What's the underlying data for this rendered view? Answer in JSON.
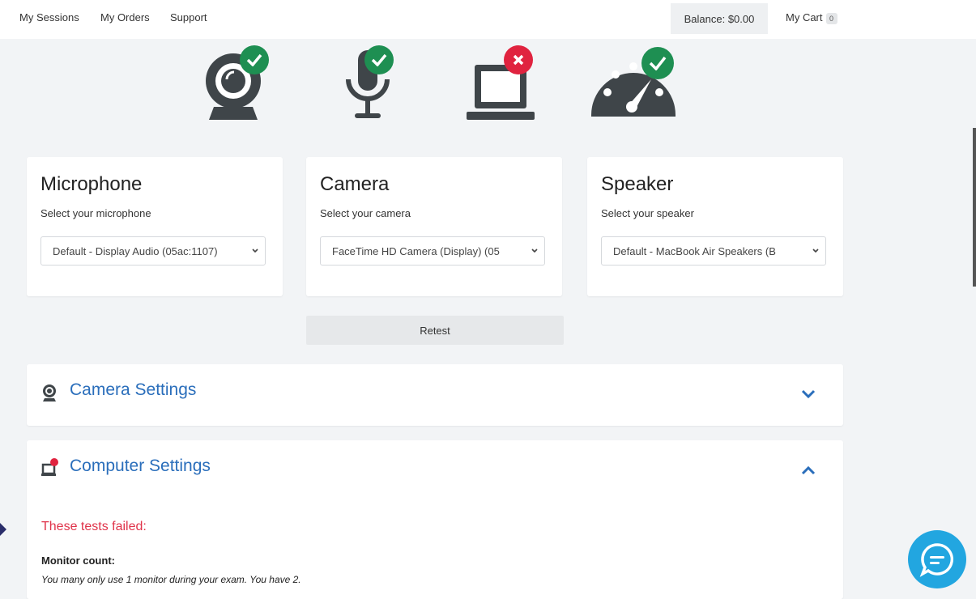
{
  "topnav": {
    "links": [
      "My Sessions",
      "My Orders",
      "Support"
    ],
    "balance": "Balance: $0.00",
    "cart_label": "My Cart",
    "cart_count": "0"
  },
  "status_icons": [
    {
      "name": "webcam",
      "status": "pass"
    },
    {
      "name": "microphone",
      "status": "pass"
    },
    {
      "name": "computer",
      "status": "fail"
    },
    {
      "name": "speedometer",
      "status": "pass"
    }
  ],
  "colors": {
    "pass": "#1e8f52",
    "fail": "#e0233f",
    "icon": "#3f4549",
    "link": "#2a6ebb",
    "chat": "#22a6e0"
  },
  "devices": {
    "microphone": {
      "title": "Microphone",
      "subtitle": "Select your microphone",
      "selected": "Default - Display Audio (05ac:1107)"
    },
    "camera": {
      "title": "Camera",
      "subtitle": "Select your camera",
      "selected": "FaceTime HD Camera (Display) (05"
    },
    "speaker": {
      "title": "Speaker",
      "subtitle": "Select your speaker",
      "selected": "Default - MacBook Air Speakers (B"
    }
  },
  "retest_label": "Retest",
  "panels": {
    "camera_settings": {
      "title": "Camera Settings",
      "expanded": false
    },
    "computer_settings": {
      "title": "Computer Settings",
      "expanded": true,
      "failed_heading": "These tests failed:",
      "tests": [
        {
          "label": "Monitor count:",
          "description": "You many only use 1 monitor during your exam. You have 2."
        }
      ]
    }
  }
}
